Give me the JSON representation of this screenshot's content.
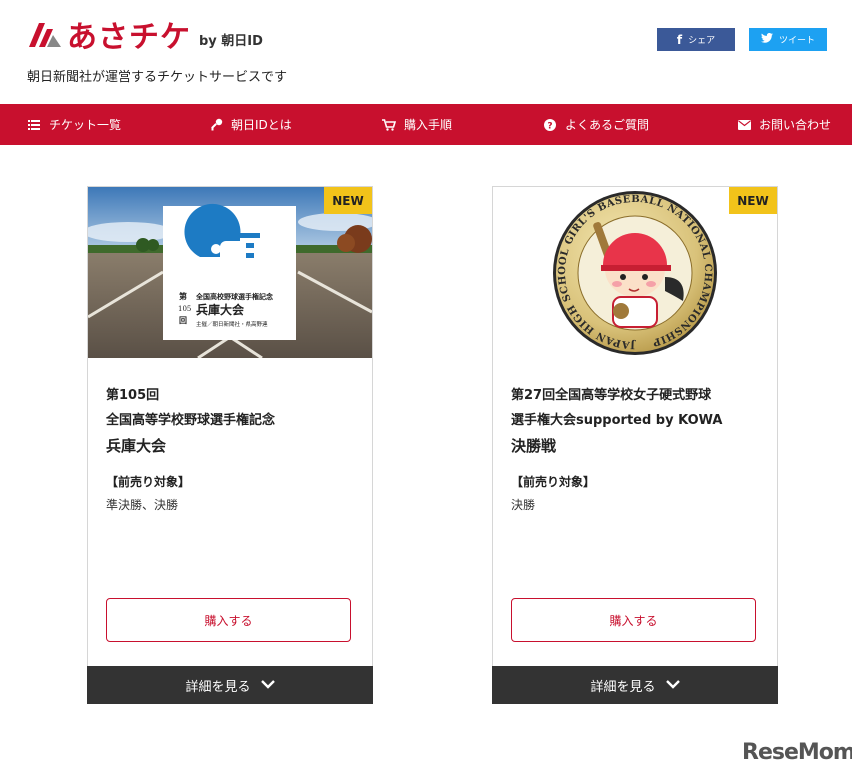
{
  "header": {
    "logo_text": "あさチケ",
    "logo_by": "by 朝日ID",
    "tagline": "朝日新聞社が運営するチケットサービスです",
    "share_label": "シェア",
    "tweet_label": "ツイート"
  },
  "nav": {
    "items": [
      {
        "label": "チケット一覧",
        "icon": "list-icon"
      },
      {
        "label": "朝日IDとは",
        "icon": "key-icon"
      },
      {
        "label": "購入手順",
        "icon": "cart-icon"
      },
      {
        "label": "よくあるご質問",
        "icon": "question-icon"
      },
      {
        "label": "お問い合わせ",
        "icon": "mail-icon"
      }
    ]
  },
  "cards": [
    {
      "badge": "NEW",
      "image_text": {
        "number": "第105回",
        "line1": "全国高校野球選手権記念",
        "line2": "兵庫大会",
        "line3": "主催／朝日新聞社・県高野連"
      },
      "title_line1": "第105回",
      "title_line2": "全国高等学校野球選手権記念",
      "title_big": "兵庫大会",
      "presale_label": "【前売り対象】",
      "presale_detail": "準決勝、決勝",
      "buy_label": "購入する",
      "detail_label": "詳細を見る"
    },
    {
      "badge": "NEW",
      "image_text": {
        "ring": "JAPAN HIGH SCHOOL GIRL'S BASEBALL NATIONAL CHAMPIONSHIP"
      },
      "title_line1": "第27回全国高等学校女子硬式野球",
      "title_line2": "選手権大会supported by KOWA",
      "title_big": "決勝戦",
      "presale_label": "【前売り対象】",
      "presale_detail": "決勝",
      "buy_label": "購入する",
      "detail_label": "詳細を見る"
    }
  ],
  "watermark": "ReseMom",
  "colors": {
    "brand_red": "#c8102e",
    "badge_yellow": "#f2c31a",
    "facebook": "#3b5998",
    "twitter": "#1da1f2",
    "dark_bar": "#333333"
  }
}
